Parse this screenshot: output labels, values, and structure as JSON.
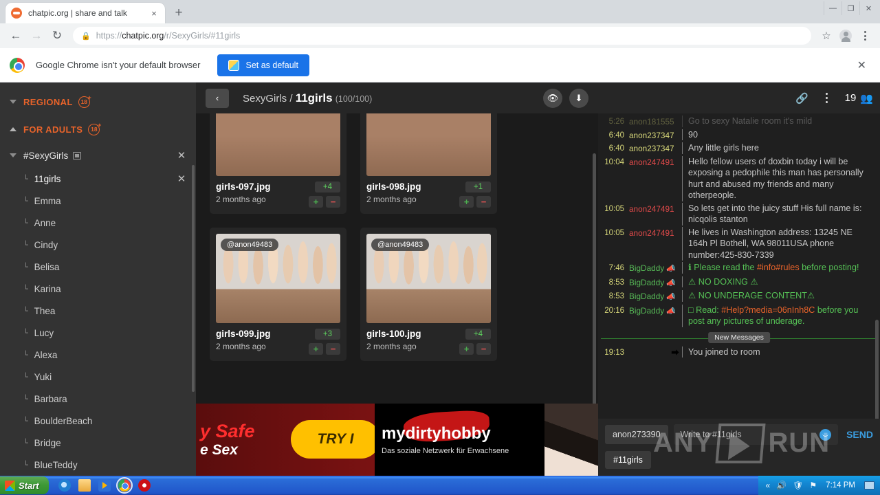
{
  "browser": {
    "tab": {
      "title": "chatpic.org | share and talk",
      "favicon": "chatpic-favicon-icon",
      "close": "×"
    },
    "newtab_label": "+",
    "window_controls": {
      "minimize": "—",
      "restore": "❐",
      "close": "✕"
    },
    "nav": {
      "back": "←",
      "forward": "→",
      "reload": "↻"
    },
    "url": {
      "lock": "🔒",
      "prefix": "https://",
      "domain": "chatpic.org",
      "path": "/r/SexyGirls/#11girls"
    },
    "omni_actions": {
      "bookmark": "☆",
      "profile": "profile-avatar-icon",
      "menu": "chrome-menu-icon"
    }
  },
  "infobar": {
    "message": "Google Chrome isn't your default browser",
    "button_label": "Set as default",
    "close": "✕"
  },
  "sidebar": {
    "categories": [
      {
        "label": "REGIONAL",
        "badge": "18",
        "expanded": false,
        "caret": "down"
      },
      {
        "label": "FOR ADULTS",
        "badge": "18",
        "expanded": true,
        "caret": "up"
      }
    ],
    "room": {
      "name": "#SexyGirls",
      "close": "✕"
    },
    "items": [
      {
        "label": "11girls",
        "active": true,
        "close": "✕"
      },
      {
        "label": "Emma",
        "active": false
      },
      {
        "label": "Anne",
        "active": false
      },
      {
        "label": "Cindy",
        "active": false
      },
      {
        "label": "Belisa",
        "active": false
      },
      {
        "label": "Karina",
        "active": false
      },
      {
        "label": "Thea",
        "active": false
      },
      {
        "label": "Lucy",
        "active": false
      },
      {
        "label": "Alexa",
        "active": false
      },
      {
        "label": "Yuki",
        "active": false
      },
      {
        "label": "Barbara",
        "active": false
      },
      {
        "label": "BoulderBeach",
        "active": false
      },
      {
        "label": "Bridge",
        "active": false
      },
      {
        "label": "BlueTeddy",
        "active": false
      }
    ]
  },
  "content": {
    "back_label": "‹",
    "breadcrumb_parent": "SexyGirls",
    "breadcrumb_sep": " / ",
    "breadcrumb_current": "11girls",
    "count": "(100/100)",
    "actions": {
      "preview": "👁",
      "download": "⬇"
    },
    "cards": [
      {
        "file": "girls-097.jpg",
        "age": "2 months ago",
        "score": "+4",
        "up": "+",
        "down": "−",
        "tag": "",
        "variant": "crop"
      },
      {
        "file": "girls-098.jpg",
        "age": "2 months ago",
        "score": "+1",
        "up": "+",
        "down": "−",
        "tag": "",
        "variant": "crop"
      },
      {
        "file": "girls-099.jpg",
        "age": "2 months ago",
        "score": "+3",
        "up": "+",
        "down": "−",
        "tag": "@anon49483",
        "variant": "people"
      },
      {
        "file": "girls-100.jpg",
        "age": "2 months ago",
        "score": "+4",
        "up": "+",
        "down": "−",
        "tag": "@anon49483",
        "variant": "people"
      }
    ],
    "ad": {
      "left_line1": "y Safe",
      "left_line2": "e Sex",
      "pill": "TRY I",
      "brand_a": "my",
      "brand_b": "dirty",
      "brand_c": "hobby",
      "subtitle": "Das soziale Netzwerk für Erwachsene"
    }
  },
  "chat": {
    "header": {
      "link": "🔗",
      "menu": "chat-menu-icon",
      "user_count": "19",
      "users_icon": "👥"
    },
    "messages": [
      {
        "time": "5:26",
        "user": "anon181555",
        "user_color": "y",
        "text": "Go to sexy Natalie room it's mild",
        "faded": true,
        "style": "plain"
      },
      {
        "time": "6:40",
        "user": "anon237347",
        "user_color": "y",
        "text": "90",
        "style": "plain"
      },
      {
        "time": "6:40",
        "user": "anon237347",
        "user_color": "y",
        "text": "Any little girls here",
        "style": "plain"
      },
      {
        "time": "10:04",
        "user": "anon247491",
        "user_color": "r",
        "text": "Hello fellow users of doxbin today i will be exposing a pedophile this man has personally hurt and abused my friends and many otherpeople.",
        "style": "plain"
      },
      {
        "time": "10:05",
        "user": "anon247491",
        "user_color": "r",
        "text": "So lets get into the juicy stuff  His full name is: nicqolis stanton",
        "style": "plain"
      },
      {
        "time": "10:05",
        "user": "anon247491",
        "user_color": "r",
        "text": "He lives in Washington address: 13245 NE 164h Pl Bothell, WA 98011USA phone number:425-830-7339",
        "style": "plain"
      },
      {
        "time": "7:46",
        "user": "BigDaddy",
        "user_color": "g",
        "megaphone": true,
        "text": "ℹ Please read the #info#rules before posting!",
        "style": "green"
      },
      {
        "time": "8:53",
        "user": "BigDaddy",
        "user_color": "g",
        "megaphone": true,
        "text": "⚠ NO DOXING ⚠",
        "style": "green"
      },
      {
        "time": "8:53",
        "user": "BigDaddy",
        "user_color": "g",
        "megaphone": true,
        "text": "⚠ NO UNDERAGE CONTENT⚠",
        "style": "green"
      },
      {
        "time": "20:16",
        "user": "BigDaddy",
        "user_color": "g",
        "megaphone": true,
        "text": "□ Read: #Help?media=06nInh8C before you post any pictures of underage.",
        "style": "green"
      }
    ],
    "new_messages_label": "New Messages",
    "join_event": {
      "time": "19:13",
      "icon": "⮕",
      "text": "You joined to room"
    },
    "input": {
      "nickname": "anon273390",
      "placeholder": "Write to #11girls",
      "emoji": "emoji-icon",
      "send_label": "SEND"
    },
    "room_tag": "#11girls"
  },
  "watermark": {
    "text": "ANY",
    "text2": "RUN"
  },
  "taskbar": {
    "start_label": "Start",
    "quick_launch": [
      "internet-explorer-icon",
      "folder-icon",
      "media-player-icon",
      "chrome-icon",
      "opera-icon"
    ],
    "tray": {
      "chevron": "«",
      "volume": "🔊",
      "shield": "🛡",
      "flag": "⚑",
      "time": "7:14 PM"
    }
  }
}
